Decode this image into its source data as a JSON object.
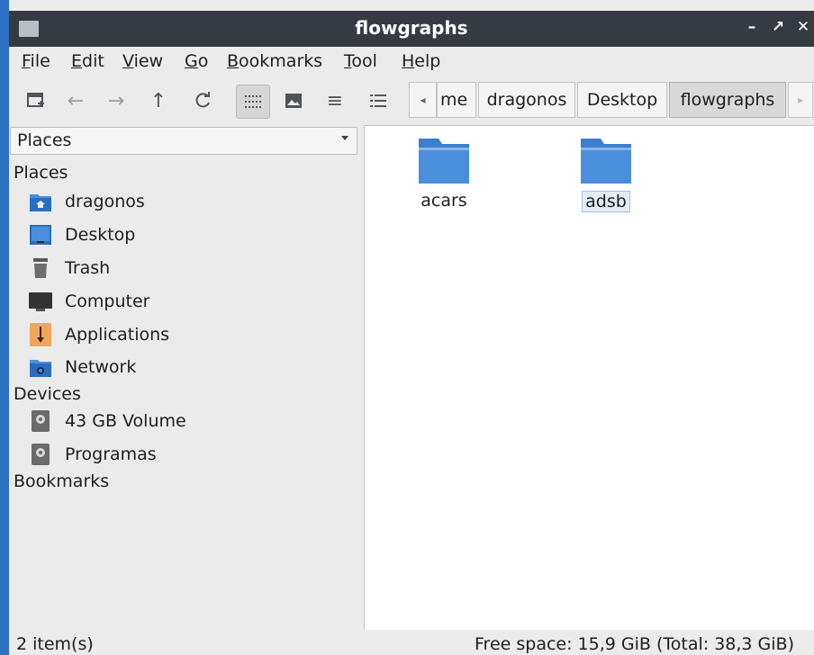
{
  "window": {
    "title": "flowgraphs"
  },
  "titlebar": {
    "minimize": "–",
    "maximize": "↗",
    "close": "✕"
  },
  "menubar": {
    "items": [
      {
        "first": "F",
        "rest": "ile"
      },
      {
        "first": "E",
        "rest": "dit"
      },
      {
        "first": "V",
        "rest": "iew"
      },
      {
        "first": "G",
        "rest": "o"
      },
      {
        "first": "B",
        "rest": "ookmarks"
      },
      {
        "first": "T",
        "rest": "ool"
      },
      {
        "first": "H",
        "rest": "elp"
      }
    ]
  },
  "toolbar": {
    "new_tab_icon": "new-tab-icon",
    "back_icon": "←",
    "forward_icon": "→",
    "up_icon": "↑",
    "reload_icon": "C",
    "icon_view": ":::",
    "thumb_view": "image",
    "compact_view": "≡",
    "list_view": "list"
  },
  "pathbar": {
    "scroll_left": "◂",
    "scroll_right": "▸",
    "crumbs": [
      "me",
      "dragonos",
      "Desktop",
      "flowgraphs"
    ]
  },
  "sidepane": {
    "combo_value": "Places",
    "places_header": "Places",
    "places": [
      "dragonos",
      "Desktop",
      "Trash",
      "Computer",
      "Applications",
      "Network"
    ],
    "devices_header": "Devices",
    "devices": [
      "43 GB Volume",
      "Programas"
    ],
    "bookmarks_header": "Bookmarks"
  },
  "files": [
    {
      "name": "acars",
      "selected": false
    },
    {
      "name": "adsb",
      "selected": true
    }
  ],
  "status": {
    "count": "2 item(s)",
    "free_space": "Free space: 15,9 GiB (Total: 38,3 GiB)"
  },
  "colors": {
    "folder": "#4a8fdc",
    "accent": "#2e6fc4",
    "titlebar": "#363b43"
  }
}
